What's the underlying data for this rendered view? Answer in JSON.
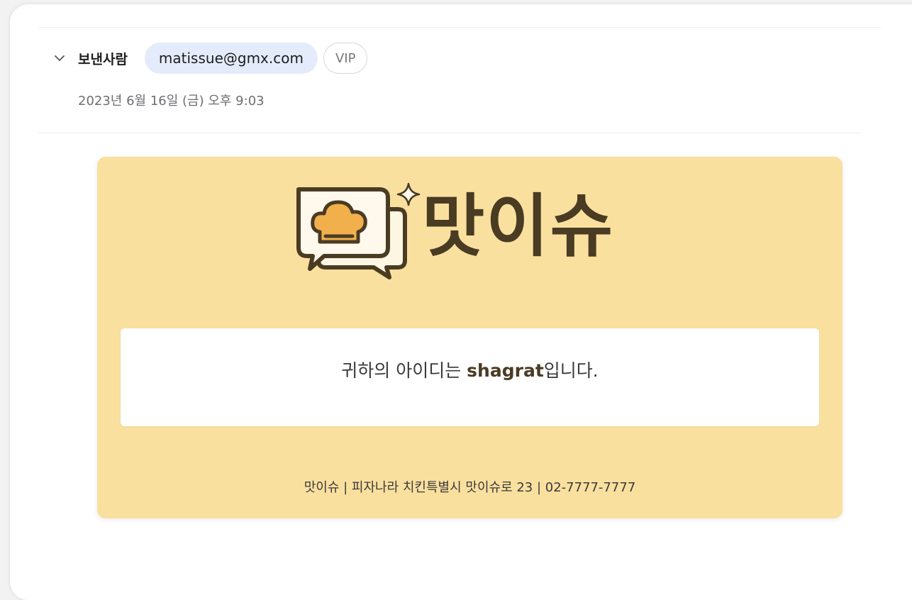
{
  "header": {
    "sender_label": "보낸사람",
    "sender_email": "matissue@gmx.com",
    "sender_badge": "VIP",
    "date": "2023년 6월 16일 (금) 오후 9:03"
  },
  "mail": {
    "brand_name": "맛이슈",
    "message_prefix": "귀하의 아이디는 ",
    "user_id": "shagrat",
    "message_suffix": "입니다.",
    "footer": "맛이슈 | 피자나라 치킨특별시 맛이슈로 23 | 02-7777-7777"
  },
  "colors": {
    "mail_background": "#fae09f",
    "brand_dark": "#4a3b23",
    "chef_hat": "#f2b04c",
    "email_pill": "#e4ecfb"
  },
  "icons": {
    "collapse": "chevron-down-icon",
    "logo": "chef-hat-chat-bubbles-icon",
    "sparkle": "sparkle-icon"
  }
}
